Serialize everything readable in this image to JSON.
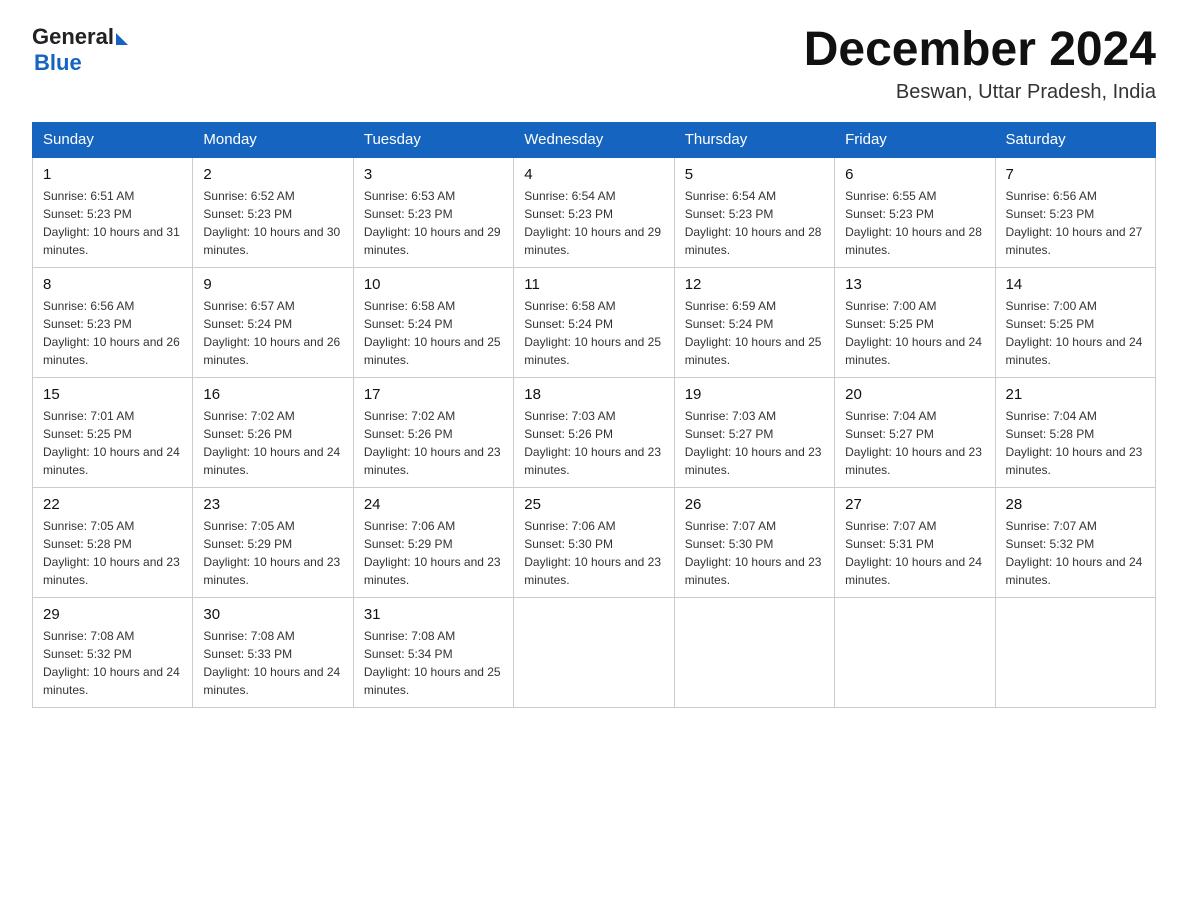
{
  "logo": {
    "general": "General",
    "blue": "Blue"
  },
  "header": {
    "month": "December 2024",
    "location": "Beswan, Uttar Pradesh, India"
  },
  "days_of_week": [
    "Sunday",
    "Monday",
    "Tuesday",
    "Wednesday",
    "Thursday",
    "Friday",
    "Saturday"
  ],
  "weeks": [
    [
      {
        "day": "1",
        "sunrise": "6:51 AM",
        "sunset": "5:23 PM",
        "daylight": "10 hours and 31 minutes."
      },
      {
        "day": "2",
        "sunrise": "6:52 AM",
        "sunset": "5:23 PM",
        "daylight": "10 hours and 30 minutes."
      },
      {
        "day": "3",
        "sunrise": "6:53 AM",
        "sunset": "5:23 PM",
        "daylight": "10 hours and 29 minutes."
      },
      {
        "day": "4",
        "sunrise": "6:54 AM",
        "sunset": "5:23 PM",
        "daylight": "10 hours and 29 minutes."
      },
      {
        "day": "5",
        "sunrise": "6:54 AM",
        "sunset": "5:23 PM",
        "daylight": "10 hours and 28 minutes."
      },
      {
        "day": "6",
        "sunrise": "6:55 AM",
        "sunset": "5:23 PM",
        "daylight": "10 hours and 28 minutes."
      },
      {
        "day": "7",
        "sunrise": "6:56 AM",
        "sunset": "5:23 PM",
        "daylight": "10 hours and 27 minutes."
      }
    ],
    [
      {
        "day": "8",
        "sunrise": "6:56 AM",
        "sunset": "5:23 PM",
        "daylight": "10 hours and 26 minutes."
      },
      {
        "day": "9",
        "sunrise": "6:57 AM",
        "sunset": "5:24 PM",
        "daylight": "10 hours and 26 minutes."
      },
      {
        "day": "10",
        "sunrise": "6:58 AM",
        "sunset": "5:24 PM",
        "daylight": "10 hours and 25 minutes."
      },
      {
        "day": "11",
        "sunrise": "6:58 AM",
        "sunset": "5:24 PM",
        "daylight": "10 hours and 25 minutes."
      },
      {
        "day": "12",
        "sunrise": "6:59 AM",
        "sunset": "5:24 PM",
        "daylight": "10 hours and 25 minutes."
      },
      {
        "day": "13",
        "sunrise": "7:00 AM",
        "sunset": "5:25 PM",
        "daylight": "10 hours and 24 minutes."
      },
      {
        "day": "14",
        "sunrise": "7:00 AM",
        "sunset": "5:25 PM",
        "daylight": "10 hours and 24 minutes."
      }
    ],
    [
      {
        "day": "15",
        "sunrise": "7:01 AM",
        "sunset": "5:25 PM",
        "daylight": "10 hours and 24 minutes."
      },
      {
        "day": "16",
        "sunrise": "7:02 AM",
        "sunset": "5:26 PM",
        "daylight": "10 hours and 24 minutes."
      },
      {
        "day": "17",
        "sunrise": "7:02 AM",
        "sunset": "5:26 PM",
        "daylight": "10 hours and 23 minutes."
      },
      {
        "day": "18",
        "sunrise": "7:03 AM",
        "sunset": "5:26 PM",
        "daylight": "10 hours and 23 minutes."
      },
      {
        "day": "19",
        "sunrise": "7:03 AM",
        "sunset": "5:27 PM",
        "daylight": "10 hours and 23 minutes."
      },
      {
        "day": "20",
        "sunrise": "7:04 AM",
        "sunset": "5:27 PM",
        "daylight": "10 hours and 23 minutes."
      },
      {
        "day": "21",
        "sunrise": "7:04 AM",
        "sunset": "5:28 PM",
        "daylight": "10 hours and 23 minutes."
      }
    ],
    [
      {
        "day": "22",
        "sunrise": "7:05 AM",
        "sunset": "5:28 PM",
        "daylight": "10 hours and 23 minutes."
      },
      {
        "day": "23",
        "sunrise": "7:05 AM",
        "sunset": "5:29 PM",
        "daylight": "10 hours and 23 minutes."
      },
      {
        "day": "24",
        "sunrise": "7:06 AM",
        "sunset": "5:29 PM",
        "daylight": "10 hours and 23 minutes."
      },
      {
        "day": "25",
        "sunrise": "7:06 AM",
        "sunset": "5:30 PM",
        "daylight": "10 hours and 23 minutes."
      },
      {
        "day": "26",
        "sunrise": "7:07 AM",
        "sunset": "5:30 PM",
        "daylight": "10 hours and 23 minutes."
      },
      {
        "day": "27",
        "sunrise": "7:07 AM",
        "sunset": "5:31 PM",
        "daylight": "10 hours and 24 minutes."
      },
      {
        "day": "28",
        "sunrise": "7:07 AM",
        "sunset": "5:32 PM",
        "daylight": "10 hours and 24 minutes."
      }
    ],
    [
      {
        "day": "29",
        "sunrise": "7:08 AM",
        "sunset": "5:32 PM",
        "daylight": "10 hours and 24 minutes."
      },
      {
        "day": "30",
        "sunrise": "7:08 AM",
        "sunset": "5:33 PM",
        "daylight": "10 hours and 24 minutes."
      },
      {
        "day": "31",
        "sunrise": "7:08 AM",
        "sunset": "5:34 PM",
        "daylight": "10 hours and 25 minutes."
      },
      null,
      null,
      null,
      null
    ]
  ]
}
